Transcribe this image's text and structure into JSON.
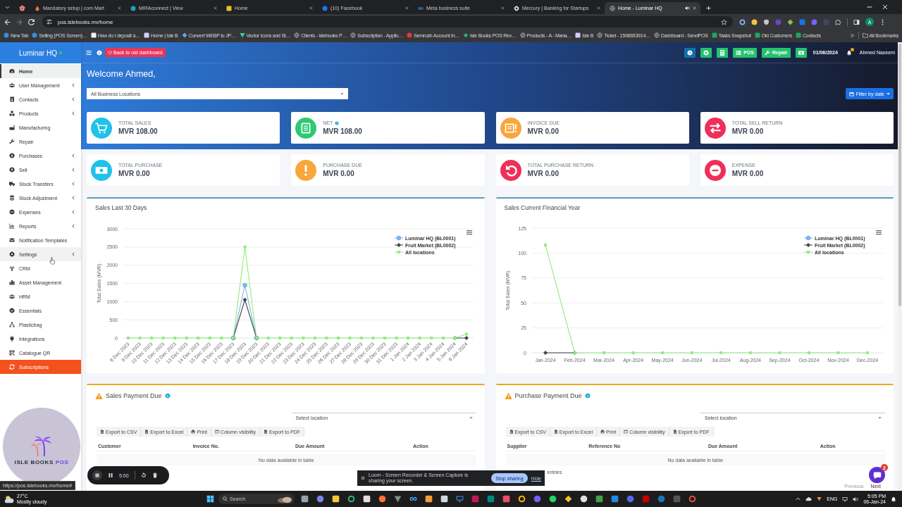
{
  "browser": {
    "tabs": [
      {
        "title": "Mandatory setup | com Mart",
        "selected": false,
        "audio": false
      },
      {
        "title": "MIRAconnect | View",
        "selected": false,
        "audio": false
      },
      {
        "title": "Home",
        "selected": false,
        "audio": false
      },
      {
        "title": "(10) Facebook",
        "selected": false,
        "audio": false
      },
      {
        "title": "Meta business suite",
        "selected": false,
        "audio": false
      },
      {
        "title": "Mercury | Banking for Startups",
        "selected": false,
        "audio": false
      },
      {
        "title": "Home - Luminar HQ",
        "selected": true,
        "audio": true
      }
    ],
    "address": "pos.islebooks.mv/home",
    "profile_initial": "A",
    "bookmarks": [
      "New Tab",
      "Selling (POS Screen)…",
      "How do I deposit a…",
      "Home | Isle B",
      "Convert WEBP to JP…",
      "Vector Icons and St…",
      "Clients - islebooks P…",
      "Subscription - Applic…",
      "Semrush Account In…",
      "Isle Books POS Rev…",
      "Products - A - Mana…",
      "Isle B",
      "Ticket - 1596653914…",
      "Dashboard - SendPOS",
      "Tasks Snapshot",
      "Old Customers",
      "Contacts"
    ],
    "all_bookmarks": "All Bookmarks"
  },
  "sidebar": {
    "brand": "Luminar HQ",
    "online": true,
    "items": [
      {
        "label": "Home",
        "kind": "normal",
        "selected": true,
        "hovered": false,
        "submenu": false
      },
      {
        "label": "User Management",
        "kind": "normal",
        "selected": false,
        "hovered": false,
        "submenu": true
      },
      {
        "label": "Contacts",
        "kind": "normal",
        "selected": false,
        "hovered": false,
        "submenu": true
      },
      {
        "label": "Products",
        "kind": "normal",
        "selected": false,
        "hovered": false,
        "submenu": true
      },
      {
        "label": "Manufacturing",
        "kind": "normal",
        "selected": false,
        "hovered": false,
        "submenu": false
      },
      {
        "label": "Repair",
        "kind": "normal",
        "selected": false,
        "hovered": false,
        "submenu": false
      },
      {
        "label": "Purchases",
        "kind": "normal",
        "selected": false,
        "hovered": false,
        "submenu": true
      },
      {
        "label": "Sell",
        "kind": "normal",
        "selected": false,
        "hovered": false,
        "submenu": true
      },
      {
        "label": "Stock Transfers",
        "kind": "normal",
        "selected": false,
        "hovered": false,
        "submenu": true
      },
      {
        "label": "Stock Adjustment",
        "kind": "normal",
        "selected": false,
        "hovered": false,
        "submenu": true
      },
      {
        "label": "Expenses",
        "kind": "normal",
        "selected": false,
        "hovered": false,
        "submenu": true
      },
      {
        "label": "Reports",
        "kind": "normal",
        "selected": false,
        "hovered": false,
        "submenu": true
      },
      {
        "label": "Notification Templates",
        "kind": "normal",
        "selected": false,
        "hovered": false,
        "submenu": false
      },
      {
        "label": "Settings",
        "kind": "normal",
        "selected": false,
        "hovered": true,
        "submenu": true
      },
      {
        "label": "CRM",
        "kind": "normal",
        "selected": false,
        "hovered": false,
        "submenu": false
      },
      {
        "label": "Asset Management",
        "kind": "normal",
        "selected": false,
        "hovered": false,
        "submenu": false
      },
      {
        "label": "HRM",
        "kind": "normal",
        "selected": false,
        "hovered": false,
        "submenu": false
      },
      {
        "label": "Essentials",
        "kind": "normal",
        "selected": false,
        "hovered": false,
        "submenu": false
      },
      {
        "label": "Plasticbag",
        "kind": "normal",
        "selected": false,
        "hovered": false,
        "submenu": false
      },
      {
        "label": "Integrations",
        "kind": "normal",
        "selected": false,
        "hovered": false,
        "submenu": false
      },
      {
        "label": "Catalogue QR",
        "kind": "normal",
        "selected": false,
        "hovered": false,
        "submenu": false
      },
      {
        "label": "Subscriptions",
        "kind": "accent",
        "selected": false,
        "hovered": false,
        "submenu": false
      }
    ],
    "logo": {
      "name": "ISLE BOOKS",
      "suffix": "POS"
    }
  },
  "topbar": {
    "old_dashboard": "Back to old dashboard",
    "actions": [
      {
        "kind": "icon",
        "color": "#1170a9"
      },
      {
        "kind": "icon",
        "color": "#25c26e"
      },
      {
        "kind": "icon",
        "color": "#25c26e"
      },
      {
        "kind": "labeled",
        "label": "POS",
        "color": "#25c26e"
      },
      {
        "kind": "labeled",
        "label": "Repair",
        "color": "#25c26e"
      },
      {
        "kind": "icon",
        "color": "#25c26e"
      }
    ],
    "date": "01/06/2024",
    "notifications": true,
    "user": "Ahmed Nazeem"
  },
  "main": {
    "welcome": "Welcome Ahmed,",
    "location": "All Business Locations",
    "date_filter": "Filter by date",
    "stats": [
      {
        "label": "TOTAL SALES",
        "value": "MVR 108.00",
        "color": "#1fc2e8",
        "info": false
      },
      {
        "label": "NET",
        "value": "MVR 108.00",
        "color": "#2ec973",
        "info": true
      },
      {
        "label": "INVOICE DUE",
        "value": "MVR 0.00",
        "color": "#f8a73a",
        "info": false
      },
      {
        "label": "TOTAL SELL RETURN",
        "value": "MVR 0.00",
        "color": "#ee2f5a",
        "info": false
      },
      {
        "label": "TOTAL PURCHASE",
        "value": "MVR 0.00",
        "color": "#1fc2e8",
        "info": false
      },
      {
        "label": "PURCHASE DUE",
        "value": "MVR 0.00",
        "color": "#f8a73a",
        "info": false
      },
      {
        "label": "TOTAL PURCHASE RETURN",
        "value": "MVR 0.00",
        "color": "#ee2f5a",
        "info": false
      },
      {
        "label": "EXPENSE",
        "value": "MVR 0.00",
        "color": "#ee2f5a",
        "info": false
      }
    ],
    "charts": [
      {
        "chart_data": {
          "type": "line",
          "title": "Sales Last 30 Days",
          "ylabel": "Total Sales (MVR)",
          "categories": [
            "8 Dec 2023",
            "9 Dec 2023",
            "10 Dec 2023",
            "11 Dec 2023",
            "12 Dec 2023",
            "13 Dec 2023",
            "14 Dec 2023",
            "15 Dec 2023",
            "16 Dec 2023",
            "17 Dec 2023",
            "18 Dec 2023",
            "19 Dec 2023",
            "20 Dec 2023",
            "21 Dec 2023",
            "22 Dec 2023",
            "23 Dec 2023",
            "24 Dec 2023",
            "25 Dec 2023",
            "26 Dec 2023",
            "27 Dec 2023",
            "28 Dec 2023",
            "29 Dec 2023",
            "30 Dec 2023",
            "31 Dec 2023",
            "1 Jan 2024",
            "2 Jan 2024",
            "3 Jan 2024",
            "4 Jan 2024",
            "5 Jan 2024",
            "6 Jan 2024"
          ],
          "series": [
            {
              "name": "Luminar HQ (BL0001)",
              "color": "#7cb5ec",
              "marker": "circle",
              "values": [
                null,
                null,
                null,
                null,
                null,
                null,
                null,
                null,
                null,
                0,
                1450,
                0,
                null,
                null,
                null,
                null,
                null,
                null,
                null,
                null,
                null,
                null,
                null,
                null,
                null,
                null,
                null,
                null,
                null,
                null
              ]
            },
            {
              "name": "Fruit Market (BL0002)",
              "color": "#434348",
              "marker": "diamond",
              "values": [
                null,
                null,
                null,
                null,
                null,
                null,
                null,
                null,
                null,
                0,
                1050,
                0,
                null,
                null,
                null,
                null,
                null,
                null,
                null,
                null,
                null,
                null,
                null,
                null,
                null,
                null,
                null,
                null,
                0,
                0
              ]
            },
            {
              "name": "All locations",
              "color": "#90ed7d",
              "marker": "square",
              "values": [
                0,
                0,
                0,
                0,
                0,
                0,
                0,
                0,
                0,
                0,
                2500,
                0,
                0,
                0,
                0,
                0,
                0,
                0,
                0,
                0,
                0,
                0,
                0,
                0,
                0,
                0,
                0,
                0,
                0,
                108
              ]
            }
          ],
          "ylim": [
            0,
            3000
          ],
          "yticks": [
            0,
            500,
            1000,
            1500,
            2000,
            2500,
            3000
          ],
          "grid": true,
          "legend": "top-right"
        }
      },
      {
        "chart_data": {
          "type": "line",
          "title": "Sales Current Financial Year",
          "ylabel": "Total Sales (MVR)",
          "categories": [
            "Jan-2024",
            "Feb-2024",
            "Mar-2024",
            "Apr-2024",
            "May-2024",
            "Jun-2024",
            "Jul-2024",
            "Aug-2024",
            "Sep-2024",
            "Oct-2024",
            "Nov-2024",
            "Dec-2024"
          ],
          "series": [
            {
              "name": "Luminar HQ (BL0001)",
              "color": "#7cb5ec",
              "marker": "circle",
              "values": [
                null,
                null,
                null,
                null,
                null,
                null,
                null,
                null,
                null,
                null,
                null,
                null
              ]
            },
            {
              "name": "Fruit Market (BL0002)",
              "color": "#434348",
              "marker": "diamond",
              "values": [
                0,
                0,
                null,
                null,
                null,
                null,
                null,
                null,
                null,
                null,
                null,
                null
              ]
            },
            {
              "name": "All locations",
              "color": "#90ed7d",
              "marker": "square",
              "values": [
                108,
                0,
                0,
                0,
                0,
                0,
                0,
                0,
                0,
                0,
                0,
                0
              ]
            }
          ],
          "ylim": [
            0,
            125
          ],
          "yticks": [
            0,
            25,
            50,
            75,
            100,
            125
          ],
          "grid": true,
          "legend": "top-right"
        }
      }
    ],
    "due_panels": [
      {
        "title": "Sales Payment Due",
        "placeholder": "Select location",
        "buttons": [
          "Export to CSV",
          "Export to Excel",
          "Print",
          "Column visibility",
          "Export to PDF"
        ],
        "columns": [
          "Customer",
          "Invoice No.",
          "Due Amount",
          "Action"
        ],
        "empty": "No data available in table"
      },
      {
        "title": "Purchase Payment Due",
        "placeholder": "Select location",
        "buttons": [
          "Export to CSV",
          "Export to Excel",
          "Print",
          "Column visibility",
          "Export to PDF"
        ],
        "columns": [
          "Supplier",
          "Reference No",
          "Due Amount",
          "Action"
        ],
        "empty": "No data available in table",
        "info": "entries",
        "pager": [
          {
            "label": "Previous",
            "disabled": true
          },
          {
            "label": "Next",
            "disabled": false
          }
        ]
      }
    ]
  },
  "recorder": {
    "time": "5:00"
  },
  "share_banner": {
    "message": "Loom - Screen Recorder & Screen Capture is sharing your screen.",
    "stop": "Stop sharing",
    "hide": "Hide"
  },
  "status_url": "https://pos.islebooks.mv/home#",
  "chat": {
    "badge": "2"
  },
  "taskbar": {
    "weather": {
      "temp": "27°C",
      "condition": "Mostly cloudy"
    },
    "search": {
      "placeholder": "Search"
    },
    "language": "ENG",
    "time": "5:05 PM",
    "date": "06-Jan-24"
  }
}
